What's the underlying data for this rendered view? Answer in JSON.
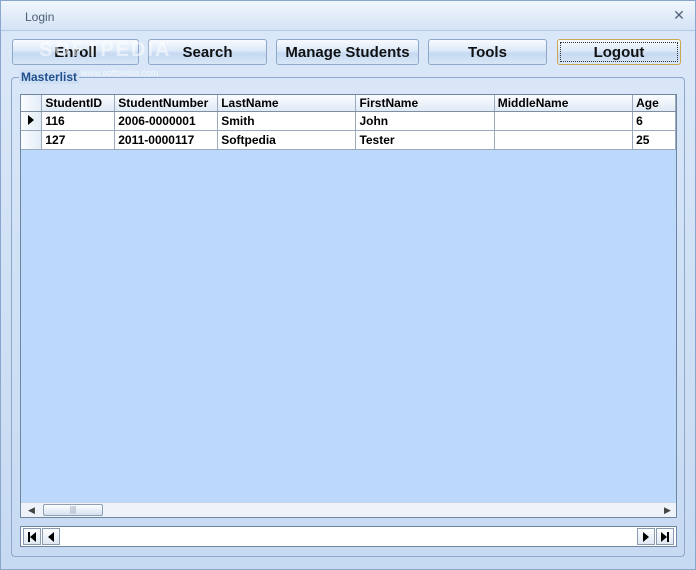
{
  "window": {
    "title": "Login",
    "close_glyph": "✕"
  },
  "watermark": {
    "main": "SOFTPEDIA",
    "sub": "www.softpedia.com"
  },
  "toolbar": {
    "enroll": "Enroll",
    "search": "Search",
    "manage_students": "Manage Students",
    "tools": "Tools",
    "logout": "Logout"
  },
  "masterlist": {
    "label": "Masterlist",
    "columns": [
      "StudentID",
      "StudentNumber",
      "LastName",
      "FirstName",
      "MiddleName",
      "Age"
    ],
    "rows": [
      {
        "current": true,
        "StudentID": "116",
        "StudentNumber": "2006-0000001",
        "LastName": "Smith",
        "FirstName": "John",
        "MiddleName": "",
        "Age": "6"
      },
      {
        "current": false,
        "StudentID": "127",
        "StudentNumber": "2011-0000117",
        "LastName": "Softpedia",
        "FirstName": "Tester",
        "MiddleName": "",
        "Age": "25"
      }
    ]
  },
  "icons": {
    "close": "close-icon",
    "row_indicator": "row-pointer-icon",
    "scroll_left": "scroll-left-icon",
    "scroll_right": "scroll-right-icon",
    "first_record": "first-record-icon",
    "prev_record": "prev-record-icon",
    "next_record": "next-record-icon",
    "last_record": "last-record-icon"
  },
  "colors": {
    "grid_bg": "#bcd9fc",
    "label": "#1f4f8c"
  }
}
